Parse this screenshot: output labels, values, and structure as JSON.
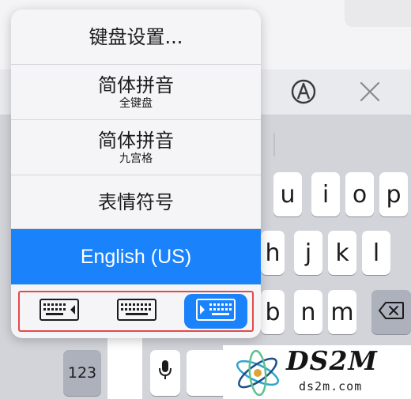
{
  "menu": {
    "items": [
      {
        "title": "键盘设置...",
        "subtitle": ""
      },
      {
        "title": "简体拼音",
        "subtitle": "全键盘"
      },
      {
        "title": "简体拼音",
        "subtitle": "九宫格"
      },
      {
        "title": "表情符号",
        "subtitle": ""
      },
      {
        "title": "English (US)",
        "subtitle": "",
        "selected": true
      }
    ],
    "layouts": [
      {
        "icon": "keyboard-left-icon",
        "selected": false
      },
      {
        "icon": "keyboard-full-icon",
        "selected": false
      },
      {
        "icon": "keyboard-right-icon",
        "selected": true
      }
    ]
  },
  "toolbar": {
    "icons": [
      "handwriting-icon",
      "close-icon"
    ]
  },
  "keys": {
    "row1": [
      "u",
      "i",
      "o",
      "p"
    ],
    "row2": [
      "h",
      "j",
      "k",
      "l"
    ],
    "row3": [
      "b",
      "n",
      "m"
    ],
    "numbers_label": "123"
  },
  "watermark": {
    "title": "DS2M",
    "subtitle": "ds2m.com"
  },
  "colors": {
    "accent": "#1a82fb",
    "highlight_border": "#e24a4a"
  }
}
